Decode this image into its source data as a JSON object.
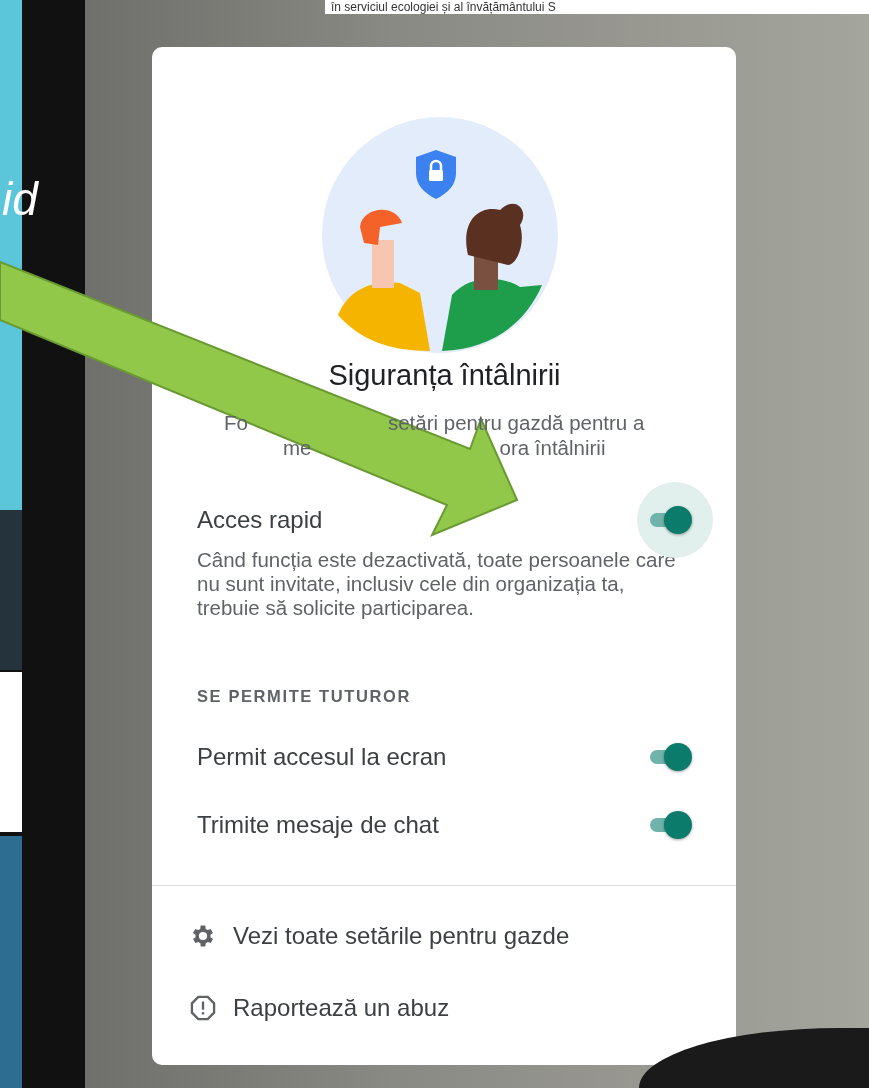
{
  "background": {
    "slide_text": "id",
    "top_text": "în serviciul ecologiei și al învățământului S"
  },
  "panel": {
    "title": "Siguranța întâlnirii",
    "description_fragments": [
      [
        "Fo",
        "setări pentru gazdă pentru a"
      ],
      [
        "me",
        "ora întâlnirii"
      ]
    ],
    "quick_access": {
      "label": "Acces rapid",
      "on": true,
      "focused": true,
      "description": "Când funcția este dezactivată, toate persoanele care nu sunt invitate, inclusiv cele din organizația ta, trebuie să solicite participarea."
    },
    "section_header": "SE PERMITE TUTUROR",
    "toggles": [
      {
        "label": "Permit accesul la ecran",
        "on": true
      },
      {
        "label": "Trimite mesaje de chat",
        "on": true
      }
    ],
    "menu": [
      {
        "kind": "settings",
        "label": "Vezi toate setările pentru gazde"
      },
      {
        "kind": "report",
        "label": "Raportează un abuz"
      }
    ]
  }
}
